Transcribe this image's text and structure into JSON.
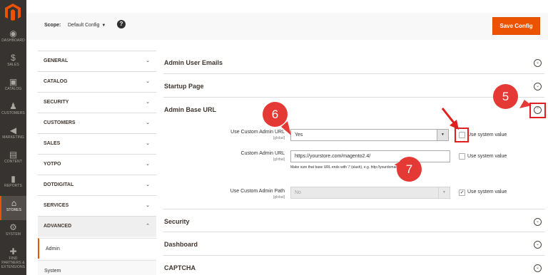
{
  "admin_nav": {
    "items": [
      {
        "label": "DASHBOARD",
        "icon": "dashboard-icon",
        "glyph": "◉"
      },
      {
        "label": "SALES",
        "icon": "dollar-icon",
        "glyph": "$"
      },
      {
        "label": "CATALOG",
        "icon": "box-icon",
        "glyph": "▣"
      },
      {
        "label": "CUSTOMERS",
        "icon": "person-icon",
        "glyph": "♟"
      },
      {
        "label": "MARKETING",
        "icon": "megaphone-icon",
        "glyph": "◀"
      },
      {
        "label": "CONTENT",
        "icon": "layout-icon",
        "glyph": "▤"
      },
      {
        "label": "REPORTS",
        "icon": "bar-chart-icon",
        "glyph": "▮"
      },
      {
        "label": "STORES",
        "icon": "store-icon",
        "glyph": "⌂"
      },
      {
        "label": "SYSTEM",
        "icon": "gear-icon",
        "glyph": "⚙"
      },
      {
        "label": "FIND PARTNERS & EXTENSIONS",
        "icon": "puzzle-icon",
        "glyph": "✚"
      }
    ],
    "active": "STORES",
    "brand_color": "#eb5202"
  },
  "header": {
    "scope_label": "Scope:",
    "scope_value": "Default Config",
    "help_glyph": "?",
    "save_label": "Save Config"
  },
  "config_tabs": {
    "groups": [
      {
        "label": "GENERAL",
        "chev": "⌄"
      },
      {
        "label": "CATALOG",
        "chev": "⌄"
      },
      {
        "label": "SECURITY",
        "chev": "⌄"
      },
      {
        "label": "CUSTOMERS",
        "chev": "⌄"
      },
      {
        "label": "SALES",
        "chev": "⌄"
      },
      {
        "label": "YOTPO",
        "chev": "⌄"
      },
      {
        "label": "DOTDIGITAL",
        "chev": "⌄"
      },
      {
        "label": "SERVICES",
        "chev": "⌄"
      },
      {
        "label": "ADVANCED",
        "chev": "⌃"
      }
    ],
    "sub_items": [
      {
        "label": "Admin",
        "active": true
      },
      {
        "label": "System",
        "active": false
      }
    ]
  },
  "sections": [
    {
      "title": "Admin User Emails",
      "chev": "⌄"
    },
    {
      "title": "Startup Page",
      "chev": "⌄"
    },
    {
      "title": "Admin Base URL",
      "chev": "⌃"
    },
    {
      "title": "Security",
      "chev": "⌄"
    },
    {
      "title": "Dashboard",
      "chev": "⌄"
    },
    {
      "title": "CAPTCHA",
      "chev": "⌄"
    }
  ],
  "admin_base_url": {
    "use_custom": {
      "label": "Use Custom Admin URL",
      "scope": "[global]",
      "value": "Yes",
      "system_label": "Use system value",
      "system_checked": false
    },
    "custom_url": {
      "label": "Custom Admin URL",
      "scope": "[global]",
      "value": "https://yourstore.com/magento2.4/",
      "note": "Make sure that base URL ends with '/' (slash), e.g. http://yourdomain/magento/",
      "system_label": "Use system value",
      "system_checked": false
    },
    "use_custom_path": {
      "label": "Use Custom Admin Path",
      "scope": "[global]",
      "value": "No",
      "system_label": "Use system value",
      "system_checked": true
    }
  },
  "annotations": {
    "callout_5": "5",
    "callout_6": "6",
    "callout_7": "7",
    "color": "#e53935"
  }
}
